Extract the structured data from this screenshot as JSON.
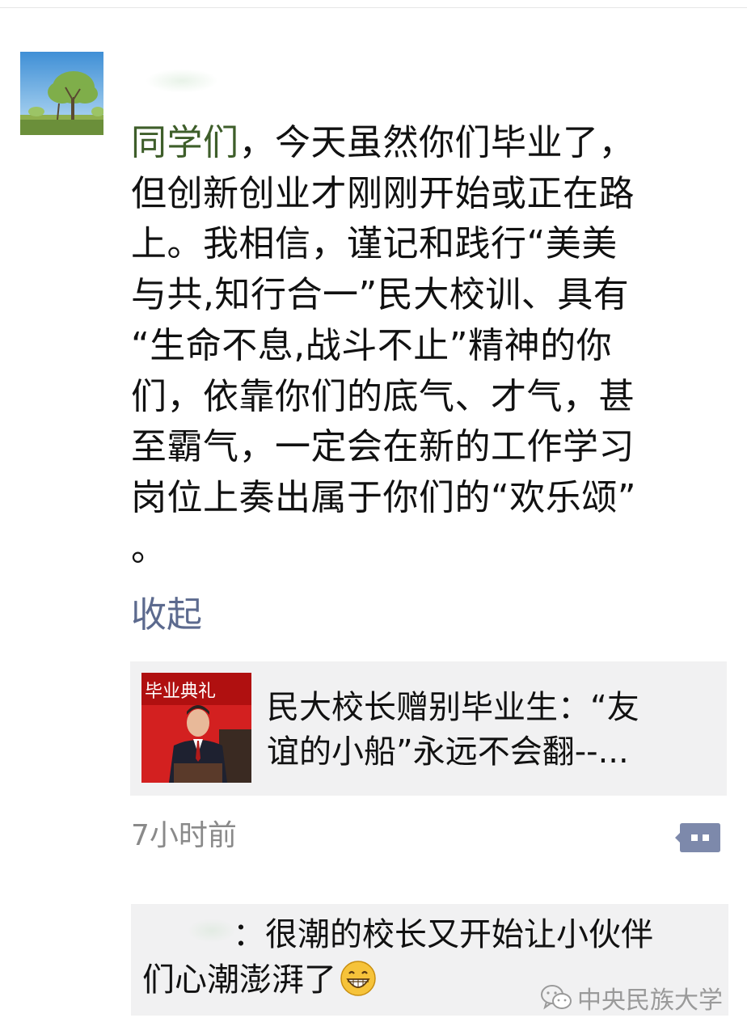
{
  "post": {
    "lines": [
      "同学们，今天虽然你们毕业了，",
      "但创新创业才刚刚开始或正在路",
      "上。我相信，谨记和践行“美美",
      "与共,知行合一”民大校训、具有",
      "“生命不息,战斗不止”精神的你",
      "们，依靠你们的底气、才气，甚",
      "至霸气，一定会在新的工作学习",
      "岗位上奏出属于你们的“欢乐颂”",
      "。"
    ],
    "lead_text": "同学们",
    "line1_rest": "，今天虽然你们毕业了，",
    "collapse_label": "收起"
  },
  "share": {
    "title_lines": [
      "民大校长赠别毕业生：“友",
      "谊的小船”永远不会翻--..."
    ],
    "thumb_banner_text": "毕业典礼"
  },
  "timestamp": "7小时前",
  "comment": {
    "lines": [
      "：很潮的校长又开始让小伙伴",
      "们心潮澎湃了"
    ],
    "emoji": "grinning-face"
  },
  "watermark": {
    "text": "中央民族大学"
  },
  "colors": {
    "username_green": "#3e5e2a",
    "link_blue": "#5c6a8e",
    "card_bg": "#f1f1f2",
    "timestamp_gray": "#8a8a8a"
  }
}
